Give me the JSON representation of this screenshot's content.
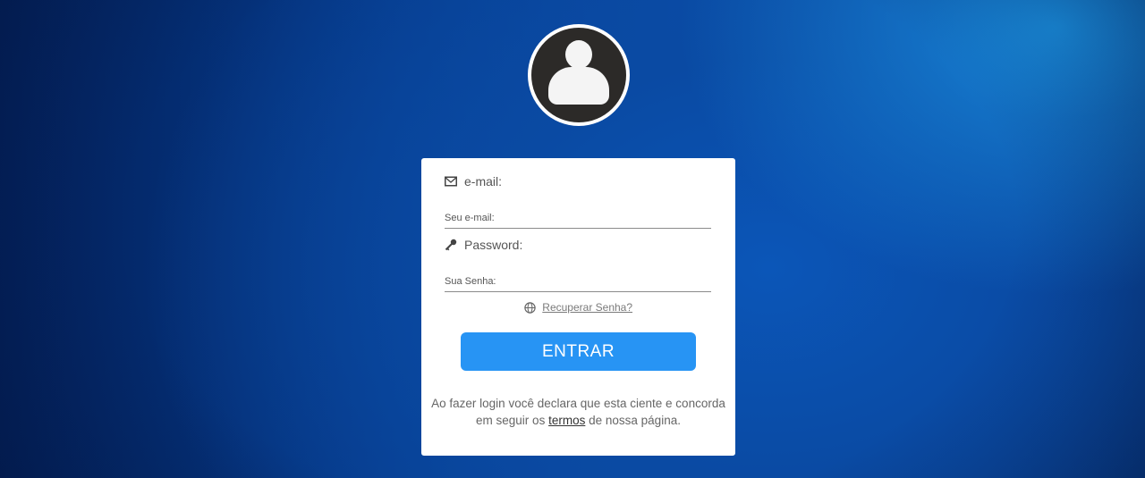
{
  "avatar": {
    "icon": "user-icon"
  },
  "login": {
    "email_label": "e-mail:",
    "email_icon": "envelope-icon",
    "email_placeholder": "Seu e-mail:",
    "email_value": "",
    "password_label": "Password:",
    "password_icon": "key-icon",
    "password_placeholder": "Sua Senha:",
    "password_value": "",
    "recover_icon": "globe-icon",
    "recover_link": "Recuperar Senha?",
    "submit_label": "ENTRAR",
    "terms_before": "Ao fazer login você declara que esta ciente e concorda em seguir os",
    "terms_link": "termos",
    "terms_after": "de nossa página."
  },
  "colors": {
    "button": "#2794f4",
    "background_dark": "#03205a",
    "background_light": "#1a8fe0"
  }
}
